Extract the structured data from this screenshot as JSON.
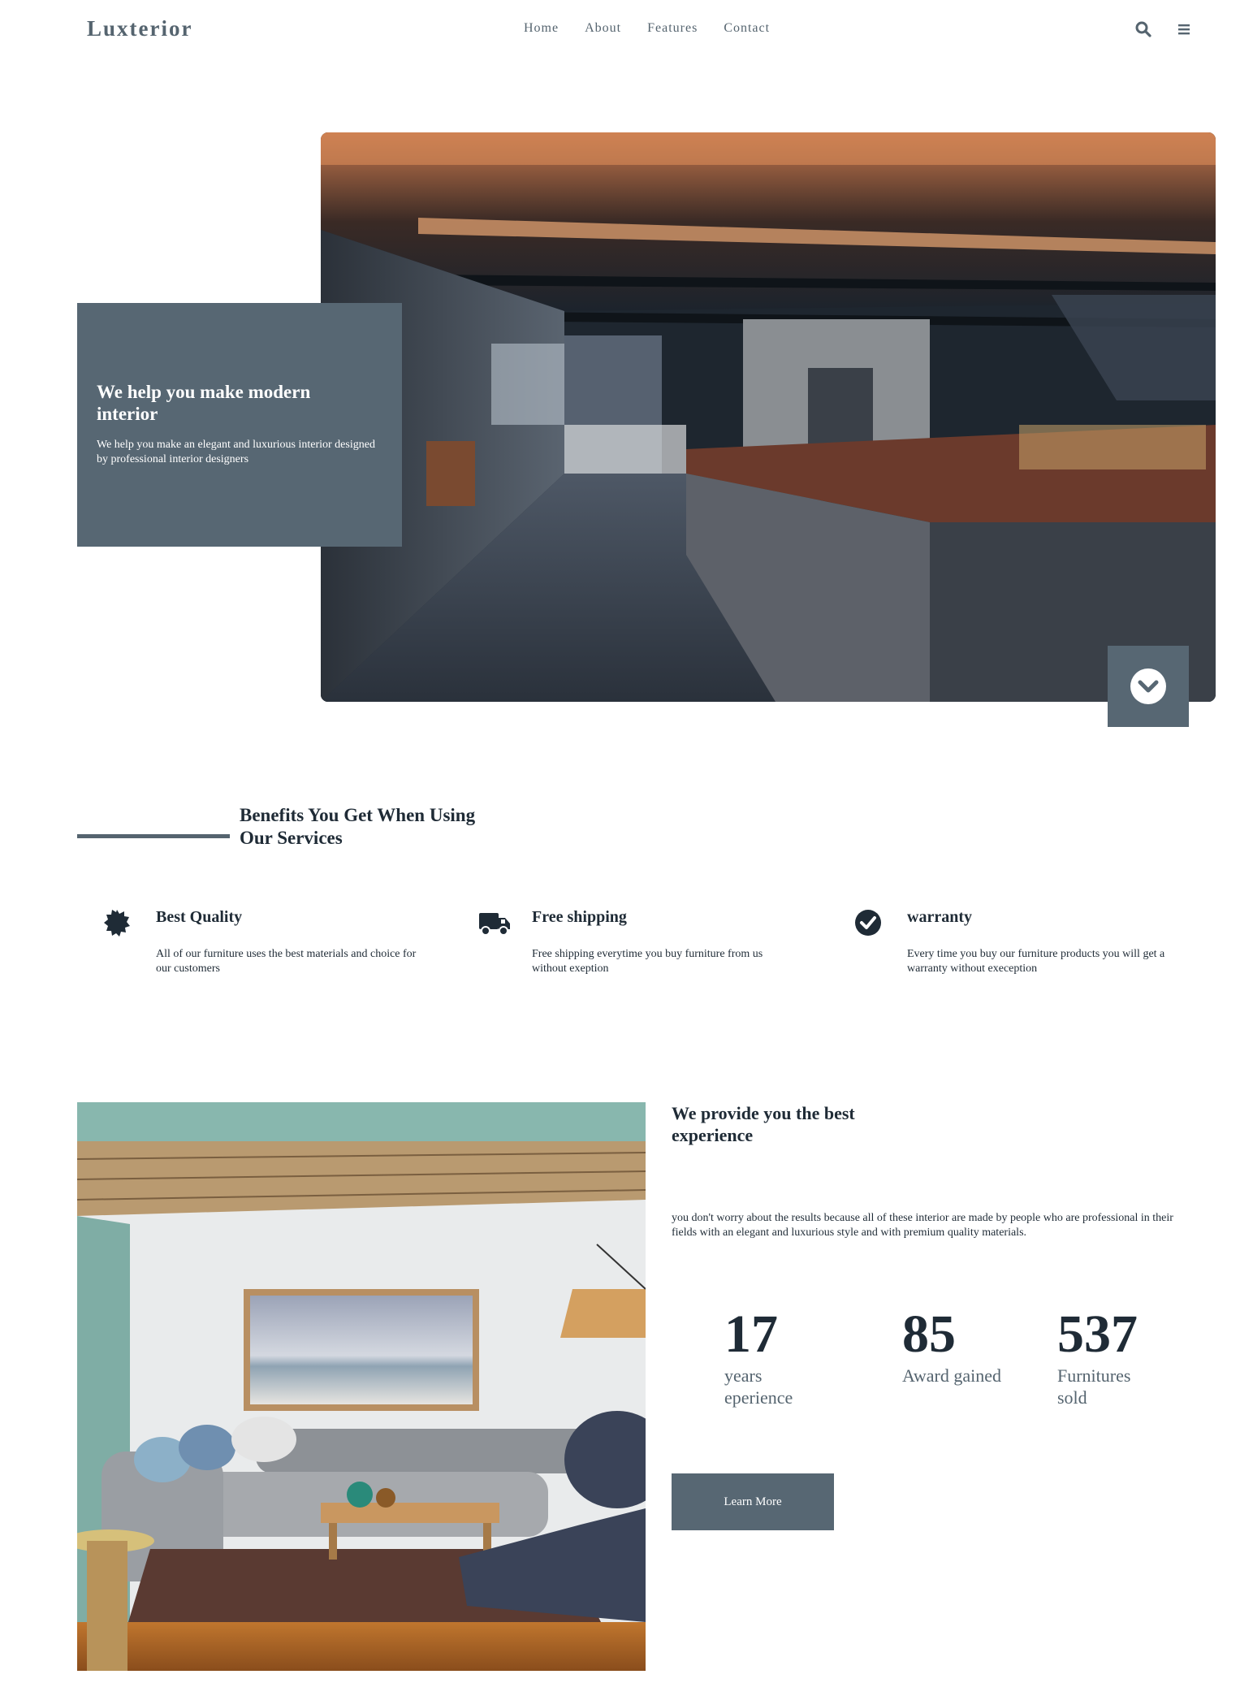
{
  "header": {
    "logo": "Luxterior",
    "nav": [
      "Home",
      "About",
      "Features",
      "Contact"
    ],
    "icons": [
      "search-icon",
      "menu-icon"
    ]
  },
  "hero": {
    "title": "We help you make modern interior",
    "subtitle": "We help you make an elegant and luxurious interior designed by professional interior designers",
    "scroll_icon": "chevron-down-icon"
  },
  "benefits": {
    "title": "Benefits You Get When Using Our Services",
    "items": [
      {
        "icon": "badge-icon",
        "title": "Best Quality",
        "text": "All of our furniture uses the best materials and choice for our customers"
      },
      {
        "icon": "truck-icon",
        "title": "Free shipping",
        "text": "Free shipping everytime you buy furniture from us without exeption"
      },
      {
        "icon": "check-circle-icon",
        "title": "warranty",
        "text": "Every time you buy our furniture products you will get a warranty without exeception"
      }
    ]
  },
  "experience": {
    "title": "We provide you the best experience",
    "description": "you don't worry about the results because all of these interior are made by people who are professional in their fields with an elegant and luxurious style and with premium quality materials.",
    "stats": [
      {
        "value": "17",
        "label": "years eperience"
      },
      {
        "value": "85",
        "label": "Award gained"
      },
      {
        "value": "537",
        "label": "Furnitures sold"
      }
    ],
    "button": "Learn More"
  },
  "colors": {
    "accent": "#576773",
    "dark": "#1f2b36",
    "muted": "#55646f"
  }
}
